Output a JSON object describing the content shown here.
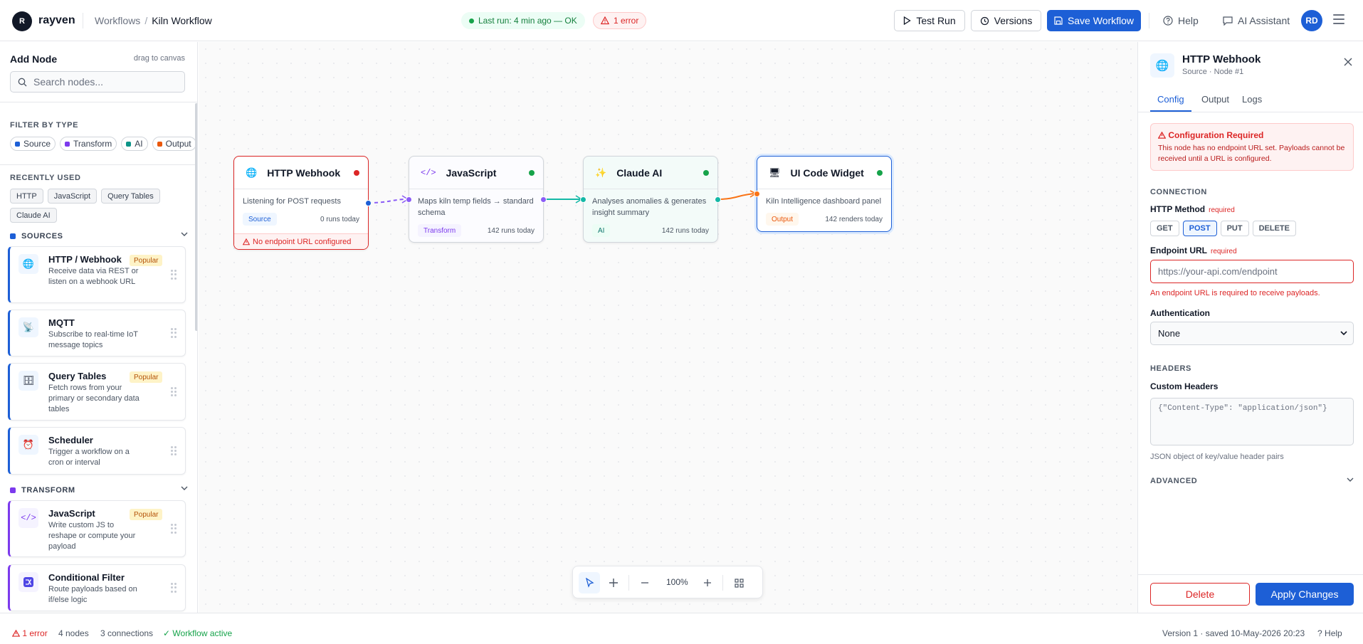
{
  "app": {
    "logo_letter": "R",
    "brand": "rayven"
  },
  "breadcrumb": {
    "parent": "Workflows",
    "separator": "/",
    "current": "Kiln Workflow"
  },
  "run_status": {
    "text": "Last run: 4 min ago — OK",
    "color": "#16a34a"
  },
  "error_badge": {
    "text": "1 error",
    "color": "#dc2626"
  },
  "toolbar": {
    "test_run": "Test Run",
    "versions": "Versions",
    "save": "Save Workflow",
    "help": "Help",
    "ai_assistant": "AI Assistant",
    "avatar": "RD"
  },
  "sidebar": {
    "title": "Add Node",
    "hint": "drag to canvas",
    "search_placeholder": "Search nodes...",
    "filter_label": "FILTER BY TYPE",
    "filters": [
      {
        "label": "Source",
        "color": "#1d5fd6"
      },
      {
        "label": "Transform",
        "color": "#7c3aed"
      },
      {
        "label": "AI",
        "color": "#0d9488"
      },
      {
        "label": "Output",
        "color": "#ea580c"
      }
    ],
    "recent_label": "RECENTLY USED",
    "recent": [
      "HTTP",
      "JavaScript",
      "Query Tables",
      "Claude AI"
    ],
    "sources_label": "SOURCES",
    "sources": [
      {
        "name": "HTTP / Webhook",
        "desc": "Receive data via REST or listen on a webhook URL",
        "badge": "Popular",
        "icon": "globe-icon"
      },
      {
        "name": "MQTT",
        "desc": "Subscribe to real-time IoT message topics",
        "badge": "",
        "icon": "antenna-icon"
      },
      {
        "name": "Query Tables",
        "desc": "Fetch rows from your primary or secondary data tables",
        "badge": "Popular",
        "icon": "database-icon"
      },
      {
        "name": "Scheduler",
        "desc": "Trigger a workflow on a cron or interval",
        "badge": "",
        "icon": "alarm-clock-icon"
      }
    ],
    "transform_label": "TRANSFORM",
    "transforms": [
      {
        "name": "JavaScript",
        "desc": "Write custom JS to reshape or compute your payload",
        "badge": "Popular",
        "icon": "code-icon"
      },
      {
        "name": "Conditional Filter",
        "desc": "Route payloads based on if/else logic",
        "badge": "",
        "icon": "filter-icon"
      }
    ]
  },
  "canvas": {
    "nodes": [
      {
        "title": "HTTP Webhook",
        "desc": "Listening for POST requests",
        "tag": "Source",
        "runs": "0 runs today",
        "status_color": "#dc2626",
        "error": "No endpoint URL configured",
        "icon": "globe-icon"
      },
      {
        "title": "JavaScript",
        "desc": "Maps kiln temp fields → standard schema",
        "tag": "Transform",
        "runs": "142 runs today",
        "status_color": "#16a34a",
        "icon": "code-icon"
      },
      {
        "title": "Claude AI",
        "desc": "Analyses anomalies & generates insight summary",
        "tag": "AI",
        "runs": "142 runs today",
        "status_color": "#16a34a",
        "icon": "sparkle-icon"
      },
      {
        "title": "UI Code Widget",
        "desc": "Kiln Intelligence dashboard panel",
        "tag": "Output",
        "runs": "142 renders today",
        "status_color": "#16a34a",
        "icon": "monitor-icon"
      }
    ],
    "zoom": "100%"
  },
  "panel": {
    "title": "HTTP Webhook",
    "subtitle": "Source · Node #1",
    "tabs": [
      "Config",
      "Output",
      "Logs"
    ],
    "alert_title": "Configuration Required",
    "alert_body": "This node has no endpoint URL set. Payloads cannot be received until a URL is configured.",
    "connection_label": "CONNECTION",
    "method_label": "HTTP Method",
    "required": "required",
    "methods": [
      "GET",
      "POST",
      "PUT",
      "DELETE"
    ],
    "selected_method": "POST",
    "endpoint_label": "Endpoint URL",
    "endpoint_placeholder": "https://your-api.com/endpoint",
    "endpoint_value": "",
    "endpoint_error": "An endpoint URL is required to receive payloads.",
    "auth_label": "Authentication",
    "auth_value": "None",
    "headers_section": "HEADERS",
    "headers_label": "Custom Headers",
    "headers_placeholder": "{\"Content-Type\": \"application/json\"}",
    "headers_hint": "JSON object of key/value header pairs",
    "advanced_label": "ADVANCED",
    "delete": "Delete",
    "apply": "Apply Changes"
  },
  "statusbar": {
    "errors": "1 error",
    "nodes": "4 nodes",
    "connections": "3 connections",
    "active": "Workflow active",
    "version": "Version 1 · saved 10-May-2026 20:23",
    "help": "Help"
  }
}
